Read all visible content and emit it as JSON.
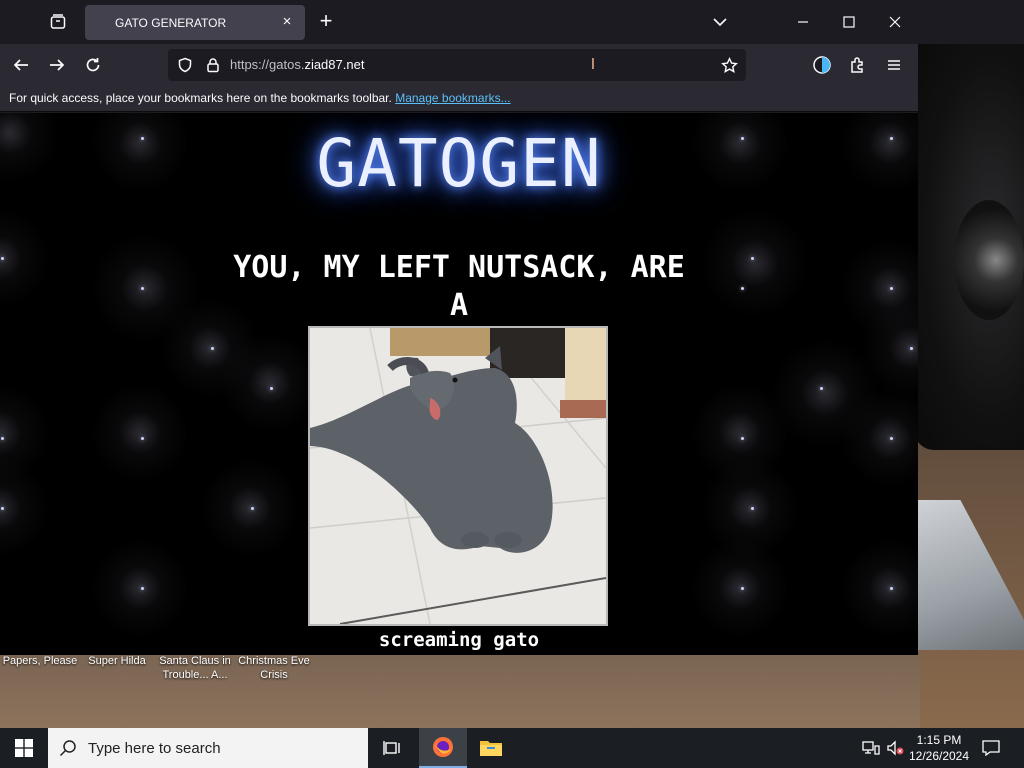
{
  "browser": {
    "tab_title": "GATO GENERATOR",
    "url_prefix": "https://gatos.",
    "url_domain": "ziad87.net",
    "bookmarks_message": "For quick access, place your bookmarks here on the bookmarks toolbar.",
    "bookmarks_link": "Manage bookmarks..."
  },
  "page": {
    "title": "GATOGEN",
    "headline_line1": "YOU, MY LEFT NUTSACK, ARE",
    "headline_line2": "A",
    "caption": "screaming gato"
  },
  "desktop": {
    "icons": [
      {
        "label": "Papers, Please"
      },
      {
        "label": "Super Hilda"
      },
      {
        "label": "Santa Claus in Trouble... A..."
      },
      {
        "label": "Christmas Eve Crisis"
      }
    ]
  },
  "taskbar": {
    "search_placeholder": "Type here to search",
    "time": "1:15 PM",
    "date": "12/26/2024"
  },
  "colors": {
    "title_glow": "#4a7aff",
    "link": "#5bc0f8",
    "tab_bg": "#42414d",
    "toolbar_bg": "#2b2a33"
  }
}
